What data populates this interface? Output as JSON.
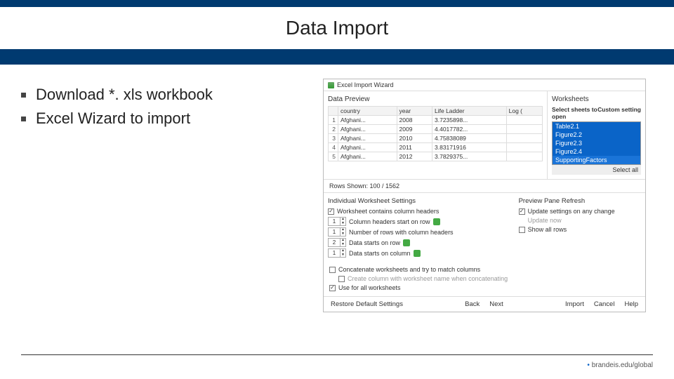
{
  "slide": {
    "title": "Data Import",
    "bullets": [
      "Download *. xls workbook",
      "Excel Wizard to import"
    ],
    "footer": "brandeis.edu/global"
  },
  "wizard": {
    "window_title": "Excel Import Wizard",
    "preview_label": "Data Preview",
    "worksheets_label": "Worksheets",
    "ws_col1": "Select sheets to open",
    "ws_col2": "Custom setting",
    "sheets": [
      "Table2.1",
      "Figure2.2",
      "Figure2.3",
      "Figure2.4",
      "SupportingFactors"
    ],
    "select_all": "Select all",
    "columns": [
      "",
      "country",
      "year",
      "Life Ladder",
      "Log ("
    ],
    "rows": [
      [
        "1",
        "Afghani...",
        "2008",
        "3.7235898..."
      ],
      [
        "2",
        "Afghani...",
        "2009",
        "4.4017782..."
      ],
      [
        "3",
        "Afghani...",
        "2010",
        "4.75838089"
      ],
      [
        "4",
        "Afghani...",
        "2011",
        "3.83171916"
      ],
      [
        "5",
        "Afghani...",
        "2012",
        "3.7829375..."
      ]
    ],
    "rows_shown": "Rows Shown: 100 / 1562",
    "iws_title": "Individual Worksheet Settings",
    "iws_chk": "Worksheet contains column headers",
    "spin_labels": [
      "Column headers start on row",
      "Number of rows with column headers",
      "Data starts on row",
      "Data starts on column"
    ],
    "spin_vals": [
      "1",
      "1",
      "2",
      "1"
    ],
    "ppr_title": "Preview Pane Refresh",
    "ppr_chk": "Update settings on any change",
    "ppr_update": "Update now",
    "ppr_show": "Show all rows",
    "concat1": "Concatenate worksheets and try to match columns",
    "concat2": "Create column with worksheet name when concatenating",
    "concat3": "Use for all worksheets",
    "btns": {
      "restore": "Restore Default Settings",
      "back": "Back",
      "next": "Next",
      "import": "Import",
      "cancel": "Cancel",
      "help": "Help"
    }
  }
}
